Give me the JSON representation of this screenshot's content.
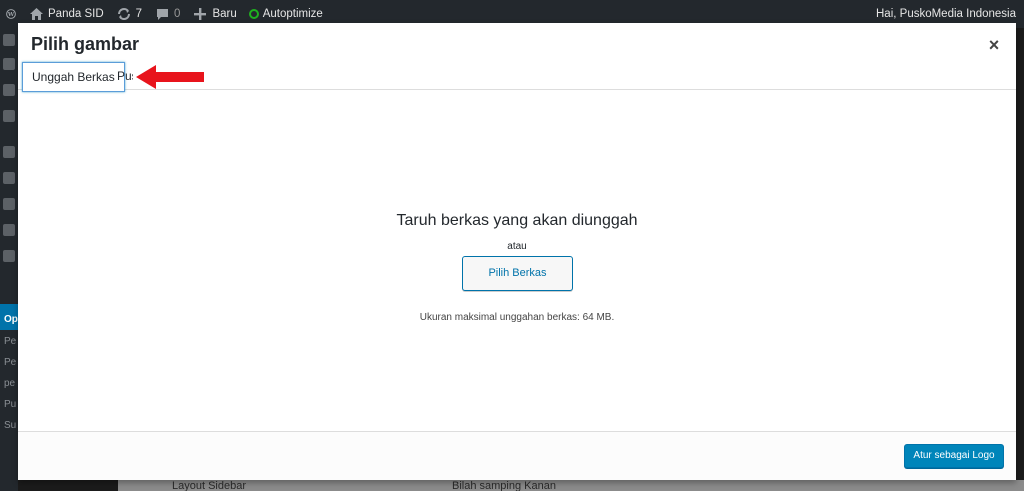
{
  "adminbar": {
    "site_name": "Panda SID",
    "updates_count": "7",
    "comments_count": "0",
    "new_label": "Baru",
    "plugin_label": "Autoptimize",
    "greeting": "Hai, PuskoMedia Indonesia"
  },
  "sidebar": {
    "items": [
      "Op",
      "Pe",
      "Pe",
      "pe",
      "Pu",
      "Su"
    ]
  },
  "background": {
    "layout_label": "Layout Sidebar",
    "layout_value": "Bilah samping Kanan"
  },
  "modal": {
    "title": "Pilih gambar",
    "close_label": "×",
    "tabs": [
      {
        "label": "Unggah Berkas"
      },
      {
        "label": "Pustaka Media"
      }
    ],
    "upload": {
      "drop_title": "Taruh berkas yang akan diunggah",
      "or_text": "atau",
      "select_button": "Pilih Berkas",
      "max_size": "Ukuran maksimal unggahan berkas: 64 MB."
    },
    "toolbar": {
      "primary_button": "Atur sebagai Logo"
    }
  },
  "colors": {
    "accent": "#0073aa",
    "primary_button": "#0085ba",
    "arrow": "#e8141c",
    "adminbar_bg": "#23282d"
  }
}
